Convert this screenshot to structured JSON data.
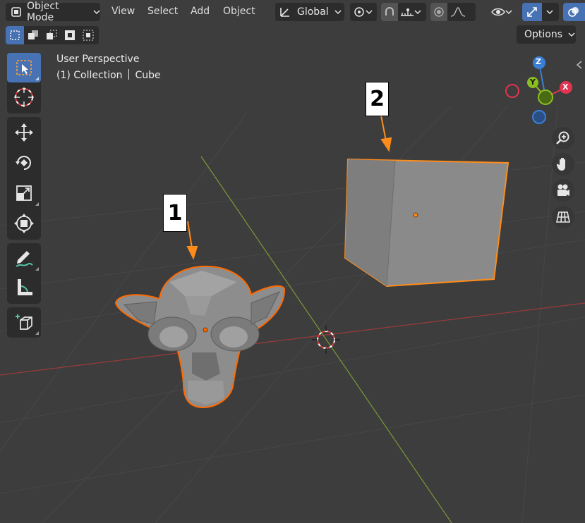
{
  "header": {
    "mode_label": "Object Mode",
    "menus": [
      "View",
      "Select",
      "Add",
      "Object"
    ],
    "orientation_label": "Global",
    "options_label": "Options"
  },
  "overlay": {
    "perspective_label": "User Perspective",
    "collection_label": "(1) Collection",
    "object_label": "Cube"
  },
  "gizmo": {
    "z_label": "Z",
    "y_label": "Y",
    "x_label": "X",
    "colors": {
      "x": "#e0344f",
      "y": "#8bbf20",
      "z": "#3a7fd6"
    }
  },
  "callouts": [
    {
      "label": "1"
    },
    {
      "label": "2"
    }
  ],
  "colors": {
    "accent": "#4772b3",
    "selection_outline": "#ff8c1a",
    "active_outline": "#ff6a00",
    "x_axis_line": "#9a3a3a",
    "y_axis_line": "#7a9a34"
  },
  "icons": {
    "toolbar": [
      "select-box-icon",
      "cursor-icon",
      "move-icon",
      "rotate-icon",
      "scale-icon",
      "transform-icon",
      "annotate-icon",
      "measure-icon",
      "add-cube-icon"
    ],
    "nav": [
      "zoom-icon",
      "hand-pan-icon",
      "camera-icon",
      "grid-view-icon"
    ]
  }
}
